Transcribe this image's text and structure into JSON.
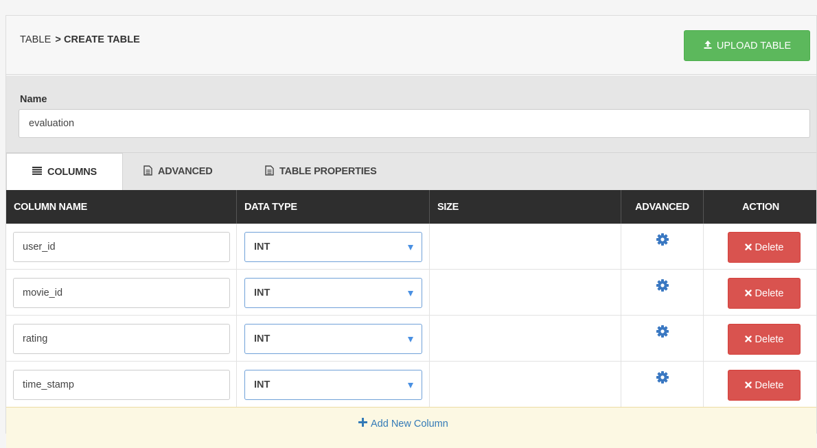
{
  "breadcrumb": {
    "parent": "TABLE",
    "separator": ">",
    "current": "CREATE TABLE"
  },
  "upload_button": {
    "label": "UPLOAD TABLE",
    "icon": "upload-icon"
  },
  "name_field": {
    "label": "Name",
    "value": "evaluation"
  },
  "tabs": [
    {
      "label": "COLUMNS",
      "icon": "list-icon",
      "active": true
    },
    {
      "label": "ADVANCED",
      "icon": "document-icon",
      "active": false
    },
    {
      "label": "TABLE PROPERTIES",
      "icon": "document-icon",
      "active": false
    }
  ],
  "table": {
    "headers": [
      "COLUMN NAME",
      "DATA TYPE",
      "SIZE",
      "ADVANCED",
      "ACTION"
    ],
    "rows": [
      {
        "column_name": "user_id",
        "data_type": "INT",
        "size": "",
        "delete_label": "Delete"
      },
      {
        "column_name": "movie_id",
        "data_type": "INT",
        "size": "",
        "delete_label": "Delete"
      },
      {
        "column_name": "rating",
        "data_type": "INT",
        "size": "",
        "delete_label": "Delete"
      },
      {
        "column_name": "time_stamp",
        "data_type": "INT",
        "size": "",
        "delete_label": "Delete"
      }
    ]
  },
  "add_column": {
    "label": "Add New Column",
    "icon": "plus-icon"
  },
  "colors": {
    "upload_green": "#5cb85c",
    "delete_red": "#d9534f",
    "header_dark": "#2e2e2e",
    "link_blue": "#337ab7",
    "gear_blue": "#3a78c2"
  }
}
